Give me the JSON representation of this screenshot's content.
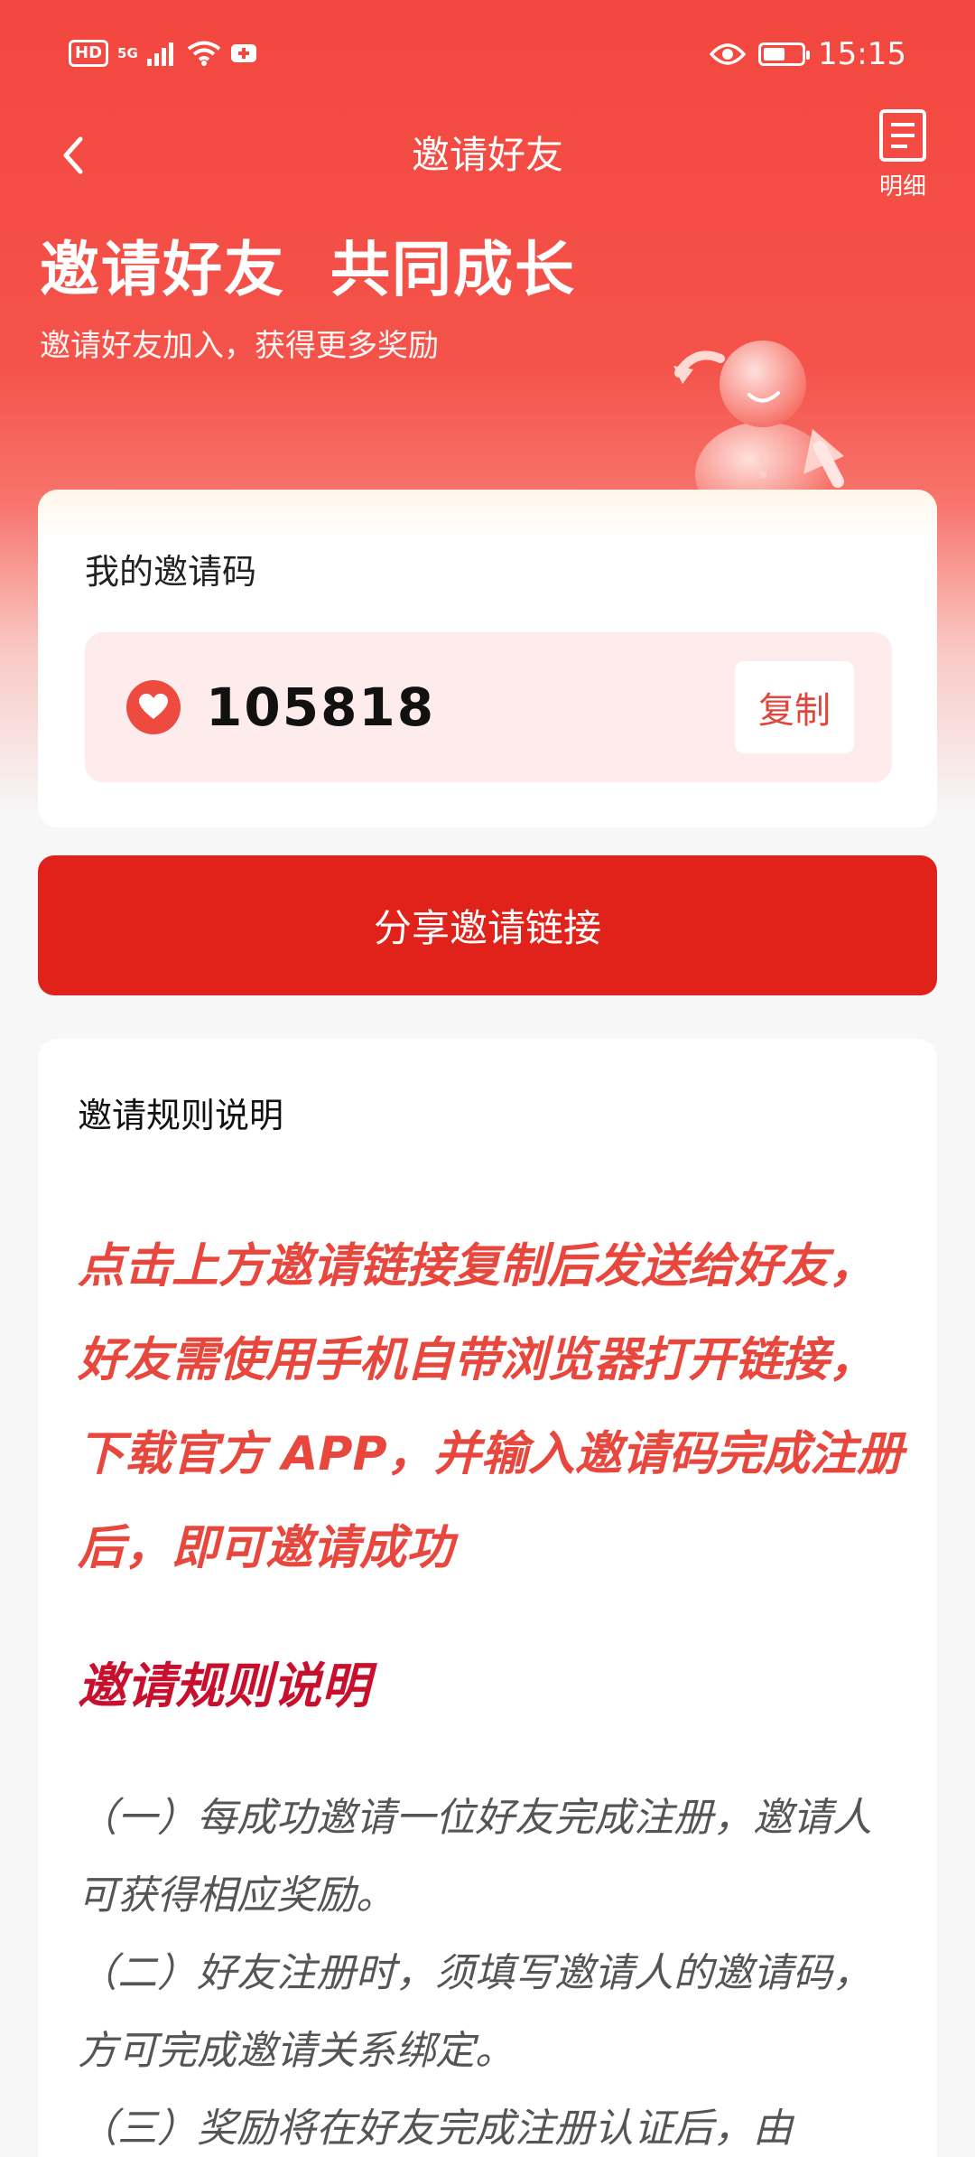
{
  "status_bar": {
    "hd": "HD",
    "network": "5G",
    "time": "15:15",
    "battery_level": 0.6
  },
  "nav": {
    "title": "邀请好友",
    "detail_label": "明细",
    "back_icon": "chevron-left-icon",
    "detail_icon": "document-list-icon"
  },
  "hero": {
    "headline": "邀请好友  共同成长",
    "subline": "邀请好友加入，获得更多奖励"
  },
  "invite_card": {
    "label": "我的邀请码",
    "code": "105818",
    "copy_label": "复制",
    "code_icon": "heart-icon"
  },
  "share_button": {
    "label": "分享邀请链接"
  },
  "rules": {
    "title": "邀请规则说明",
    "highlight": "点击上方邀请链接复制后发送给好友，好友需使用手机自带浏览器打开链接，下载官方 APP，并输入邀请码完成注册后，即可邀请成功",
    "subtitle": "邀请规则说明",
    "items": [
      "（一）每成功邀请一位好友完成注册，邀请人可获得相应奖励。",
      "（二）好友注册时，须填写邀请人的邀请码，方可完成邀请关系绑定。",
      "（三）奖励将在好友完成注册认证后，由"
    ]
  },
  "colors": {
    "brand_red": "#f3473f",
    "button_red": "#e0221a",
    "rules_red": "#c8102e"
  }
}
